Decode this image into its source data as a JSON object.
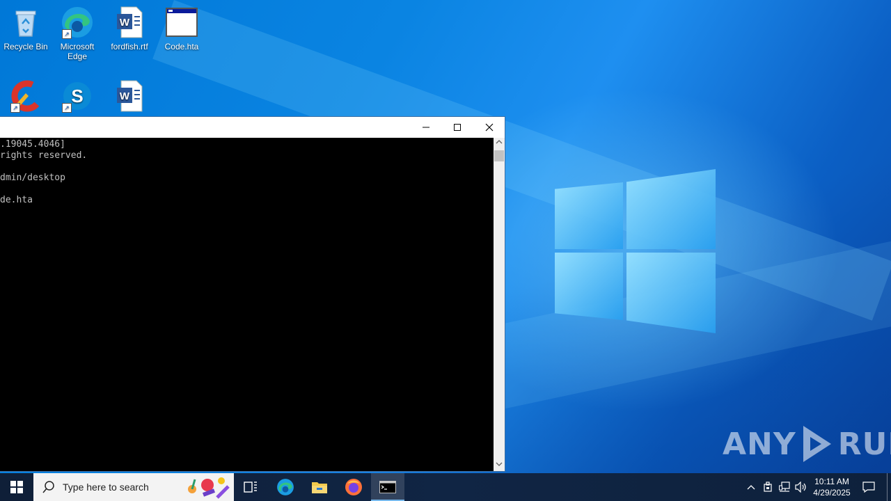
{
  "desktop": {
    "icons": [
      {
        "label": "Recycle Bin",
        "icon": "recycle-bin-icon"
      },
      {
        "label": "Microsoft Edge",
        "icon": "edge-icon"
      },
      {
        "label": "fordfish.rtf",
        "icon": "word-document-icon"
      },
      {
        "label": "Code.hta",
        "icon": "hta-application-icon"
      },
      {
        "label": "",
        "icon": "ccleaner-icon"
      },
      {
        "label": "",
        "icon": "skype-icon"
      },
      {
        "label": "",
        "icon": "word-document-icon"
      }
    ]
  },
  "console": {
    "lines": [
      ".19045.4046]",
      "rights reserved.",
      "",
      "dmin/desktop",
      "",
      "de.hta"
    ],
    "buttons": {
      "minimize": "—",
      "maximize": "☐",
      "close": "✕"
    }
  },
  "watermark": {
    "text_left": "ANY",
    "text_right": "RUN"
  },
  "taskbar": {
    "search_placeholder": "Type here to search",
    "apps": [
      "task-view-icon",
      "edge-icon",
      "file-explorer-icon",
      "firefox-icon",
      "cmd-icon"
    ],
    "active_app": "cmd-icon",
    "clock": {
      "time": "10:11 AM",
      "date": "4/29/2025"
    }
  },
  "colors": {
    "accent": "#0078d7",
    "taskbar": "#102544",
    "console_bg": "#000000",
    "console_text": "#c0c0c0"
  }
}
